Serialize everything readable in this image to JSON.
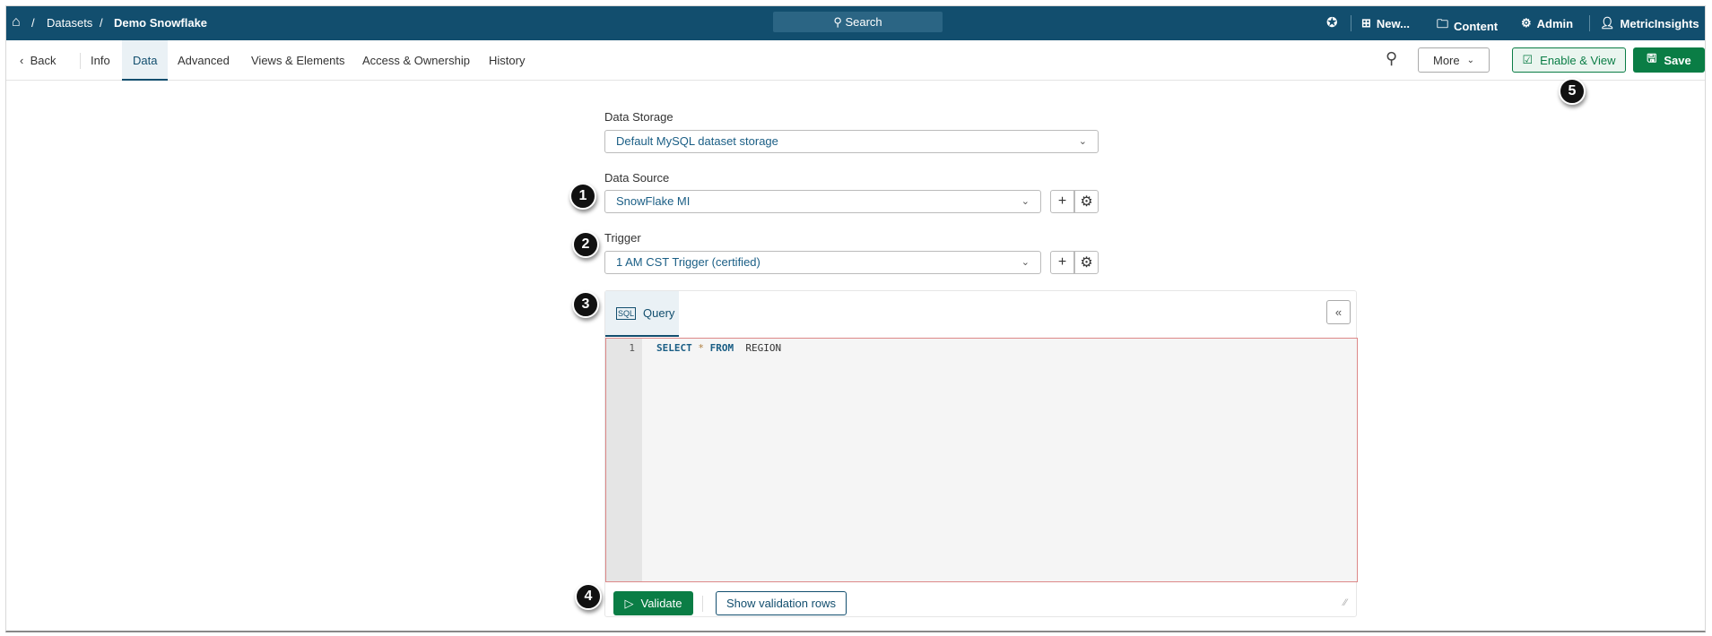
{
  "header": {
    "breadcrumb": [
      "Datasets",
      "Demo Snowflake"
    ],
    "separator": "/",
    "search_label": "Search",
    "new_label": "New...",
    "content_label": "Content",
    "admin_label": "Admin",
    "user_label": "MetricInsights"
  },
  "tabs": {
    "back": "Back",
    "items": [
      "Info",
      "Data",
      "Advanced",
      "Views & Elements",
      "Access & Ownership",
      "History"
    ],
    "active": "Data"
  },
  "toolbar": {
    "more_label": "More",
    "enable_view_label": "Enable & View",
    "save_label": "Save"
  },
  "form": {
    "data_storage_label": "Data Storage",
    "data_storage_value": "Default MySQL dataset storage",
    "data_source_label": "Data Source",
    "data_source_value": "SnowFlake MI",
    "trigger_label": "Trigger",
    "trigger_value": "1 AM CST Trigger (certified)"
  },
  "query": {
    "tab_label": "Query",
    "collapse_label": "«",
    "line_number": "1",
    "code": {
      "kw1": "SELECT",
      "op": "*",
      "kw2": "FROM",
      "ident": "REGION"
    },
    "validate_label": "Validate",
    "show_rows_label": "Show validation rows"
  },
  "badges": [
    "1",
    "2",
    "3",
    "4",
    "5"
  ],
  "colors": {
    "header": "#124e6e",
    "primary_green": "#0a7d45",
    "link": "#1a5e85"
  }
}
